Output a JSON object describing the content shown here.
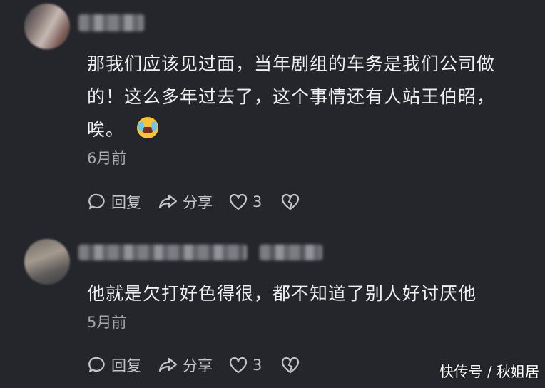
{
  "comments": [
    {
      "text_line1": "那我们应该见过面，当年剧组的车务是我们公司做",
      "text_line2": "的！这么多年过去了，这个事情还有人站王伯昭，",
      "text_line3": "唉。",
      "time": "6月前",
      "reply_label": "回复",
      "share_label": "分享",
      "like_count": "3"
    },
    {
      "text_line1": "他就是欠打好色得很，都不知道了别人好讨厌他",
      "time": "5月前",
      "reply_label": "回复",
      "share_label": "分享",
      "like_count": "3"
    }
  ],
  "watermark": "快传号 / 秋姐居",
  "colors": {
    "background": "#25262b",
    "text": "#eef0f2",
    "muted": "#a7a9ae",
    "emoji": "#f6c33a"
  }
}
